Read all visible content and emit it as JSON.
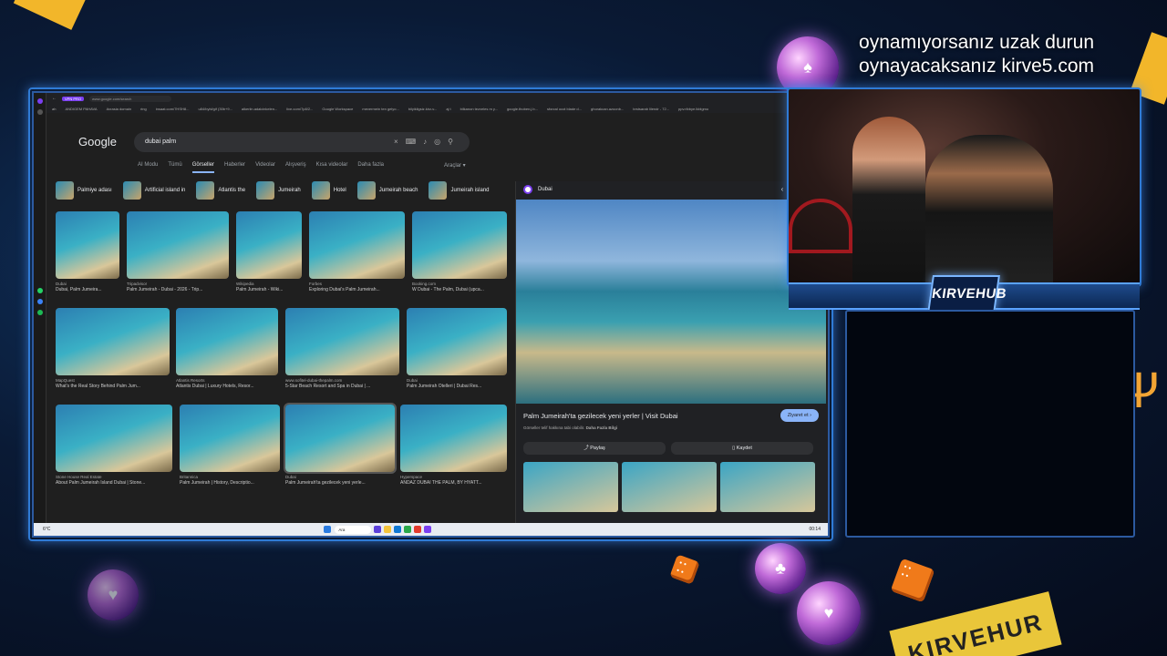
{
  "overlay": {
    "promo_line1": "oynamıyorsanız uzak durun",
    "promo_line2": "oynayacaksanız kirve5.com",
    "brand": "KIRVEHUB",
    "banner": "KIRVEHUR"
  },
  "browser": {
    "vpn_label": "VPN PRO",
    "url": "www.google.com/search",
    "bookmarks": [
      "ah",
      "ANDIGEM PAHAVA",
      "Avrasia domain",
      "ring",
      "insaat.com/7HSH8...",
      "u84/bybl/gif (30b+9...",
      "alkeriin.adalcinkelen...",
      "live.com/7p8/2...",
      "Google Workspace",
      "mevermein ten gelyo...",
      "bilyikligsiz.kirz-v...",
      "aj t",
      "bilkanon tezveles m y...",
      "google.thoben.j.b...",
      "sforzal ocot blade d...",
      "ghorakcan.azoonb...",
      "brstsarab lilendr - 72...",
      "ppv.ribbye.lkblgmo"
    ]
  },
  "google": {
    "logo": "Google",
    "query": "dubai palm",
    "tabs": [
      "AI Modu",
      "Tümü",
      "Görseller",
      "Haberler",
      "Videolar",
      "Alışveriş",
      "Kısa videolar",
      "Daha fazla"
    ],
    "active_tab": "Görseller",
    "tools": "Araçlar",
    "chips": [
      "Palmiye adası",
      "Artificial island in",
      "Atlantis the",
      "Jumeirah",
      "Hotel",
      "Jumeirah beach",
      "Jumeirah island"
    ],
    "results": [
      {
        "source": "Dubai",
        "caption": "Dubai, Palm Jumeira..."
      },
      {
        "source": "Tripadvisor",
        "caption": "Palm Jumeirah - Dubai - 2026 - Trip..."
      },
      {
        "source": "Wikipedia",
        "caption": "Palm Jumeirah - Wiki..."
      },
      {
        "source": "Forbes",
        "caption": "Exploring Dubai's Palm Jumeirah..."
      },
      {
        "source": "Booking.com",
        "caption": "W Dubai - The Palm, Dubai (upca..."
      },
      {
        "source": "MapQuest",
        "caption": "What's the Real Story Behind Palm Jum..."
      },
      {
        "source": "Atlantis Resorts",
        "caption": "Atlantis Dubai | Luxury Hotels, Resor..."
      },
      {
        "source": "www.sofitel-dubai-thepalm.com",
        "caption": "5-Star Beach Resort and Spa in Dubai | ..."
      },
      {
        "source": "Dubai",
        "caption": "Palm Jumeirah Otelleri | Dubai Res..."
      },
      {
        "source": "Stone House Real Estate",
        "caption": "About Palm Jumeirah Island Dubai | Stone..."
      },
      {
        "source": "Britannica",
        "caption": "Palm Jumeirah | History, Descriptio..."
      },
      {
        "source": "Dubai",
        "caption": "Palm Jumeirah'ta gezilecek yeni yerle..."
      },
      {
        "source": "Hyperspace",
        "caption": "ANDAZ DUBAI THE PALM, BY HYATT..."
      }
    ],
    "preview": {
      "site": "Dubai",
      "title": "Palm Jumeirah'ta gezilecek yeni yerler | Visit Dubai",
      "visit_label": "Ziyaret et",
      "subtitle_prefix": "Görseller telif hakkına tabi olabilir.",
      "subtitle_link": "Daha Fazla Bilgi",
      "share_label": "Paylaş",
      "save_label": "Kaydet"
    }
  },
  "taskbar": {
    "weather": "6°C",
    "search_placeholder": "Ara",
    "time": "00:14"
  }
}
